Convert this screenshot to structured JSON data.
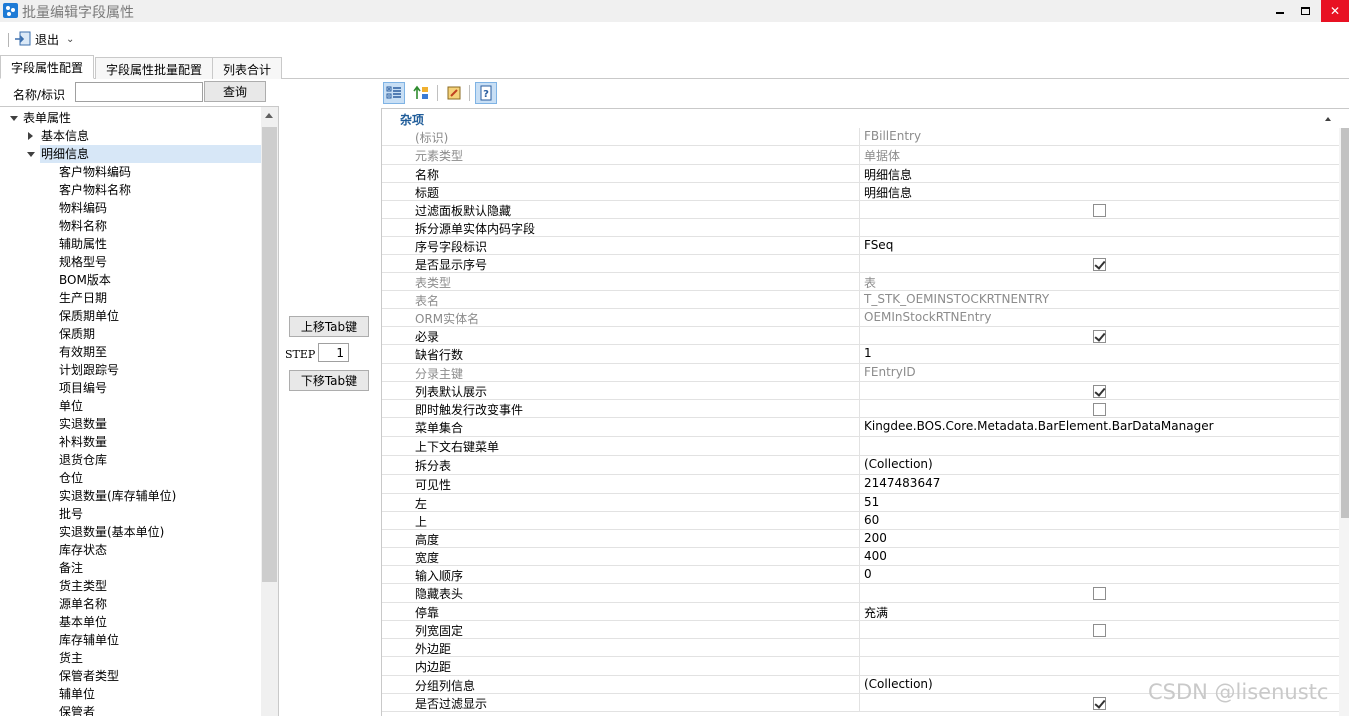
{
  "window": {
    "title": "批量编辑字段属性",
    "minimize_label": "",
    "maximize_label": "",
    "close_label": "✕"
  },
  "toolbar": {
    "exit_label": "退出"
  },
  "tabs": [
    {
      "label": "字段属性配置",
      "active": true
    },
    {
      "label": "字段属性批量配置",
      "active": false
    },
    {
      "label": "列表合计",
      "active": false
    }
  ],
  "search": {
    "label": "名称/标识",
    "value": "",
    "button_label": "查询"
  },
  "tree": {
    "root": "表单属性",
    "groups": [
      {
        "label": "基本信息",
        "expanded": false
      },
      {
        "label": "明细信息",
        "expanded": true,
        "selected": true
      }
    ],
    "items": [
      "客户物料编码",
      "客户物料名称",
      "物料编码",
      "物料名称",
      "辅助属性",
      "规格型号",
      "BOM版本",
      "生产日期",
      "保质期单位",
      "保质期",
      "有效期至",
      "计划跟踪号",
      "项目编号",
      "单位",
      "实退数量",
      "补料数量",
      "退货仓库",
      "仓位",
      "实退数量(库存辅单位)",
      "批号",
      "实退数量(基本单位)",
      "库存状态",
      "备注",
      "货主类型",
      "源单名称",
      "基本单位",
      "库存辅单位",
      "货主",
      "保管者类型",
      "辅单位",
      "保管者"
    ]
  },
  "middle": {
    "move_up_label": "上移Tab键",
    "step_label": "STEP",
    "step_value": "1",
    "move_down_label": "下移Tab键"
  },
  "property_grid": {
    "category": "杂项",
    "rows": [
      {
        "name": "(标识)",
        "value": "FBillEntry",
        "readonly": true
      },
      {
        "name": "元素类型",
        "value": "单据体",
        "readonly": true
      },
      {
        "name": "名称",
        "value": "明细信息"
      },
      {
        "name": "标题",
        "value": "明细信息"
      },
      {
        "name": "过滤面板默认隐藏",
        "checkbox": false
      },
      {
        "name": "拆分源单实体内码字段",
        "value": ""
      },
      {
        "name": "序号字段标识",
        "value": "FSeq"
      },
      {
        "name": "是否显示序号",
        "checkbox": true
      },
      {
        "name": "表类型",
        "value": "表",
        "readonly": true
      },
      {
        "name": "表名",
        "value": "T_STK_OEMINSTOCKRTNENTRY",
        "readonly": true
      },
      {
        "name": "ORM实体名",
        "value": "OEMInStockRTNEntry",
        "readonly": true
      },
      {
        "name": "必录",
        "checkbox": true
      },
      {
        "name": "缺省行数",
        "value": "1"
      },
      {
        "name": "分录主键",
        "value": "FEntryID",
        "readonly": true
      },
      {
        "name": "列表默认展示",
        "checkbox": true
      },
      {
        "name": "即时触发行改变事件",
        "checkbox": false
      },
      {
        "name": "菜单集合",
        "value": "Kingdee.BOS.Core.Metadata.BarElement.BarDataManager"
      },
      {
        "name": "上下文右键菜单",
        "value": ""
      },
      {
        "name": "拆分表",
        "value": "(Collection)"
      },
      {
        "name": "可见性",
        "value": "2147483647"
      },
      {
        "name": "左",
        "value": "51"
      },
      {
        "name": "上",
        "value": "60"
      },
      {
        "name": "高度",
        "value": "200"
      },
      {
        "name": "宽度",
        "value": "400"
      },
      {
        "name": "输入顺序",
        "value": "0"
      },
      {
        "name": "隐藏表头",
        "checkbox": false
      },
      {
        "name": "停靠",
        "value": "充满"
      },
      {
        "name": "列宽固定",
        "checkbox": false
      },
      {
        "name": "外边距",
        "value": ""
      },
      {
        "name": "内边距",
        "value": ""
      },
      {
        "name": "分组列信息",
        "value": "(Collection)"
      },
      {
        "name": "是否过滤显示",
        "checkbox": true
      }
    ]
  },
  "watermark": "CSDN @lisenustc",
  "colors": {
    "category_text": "#1f5c99",
    "selection": "#d7e7f7",
    "close_button": "#e81123"
  }
}
